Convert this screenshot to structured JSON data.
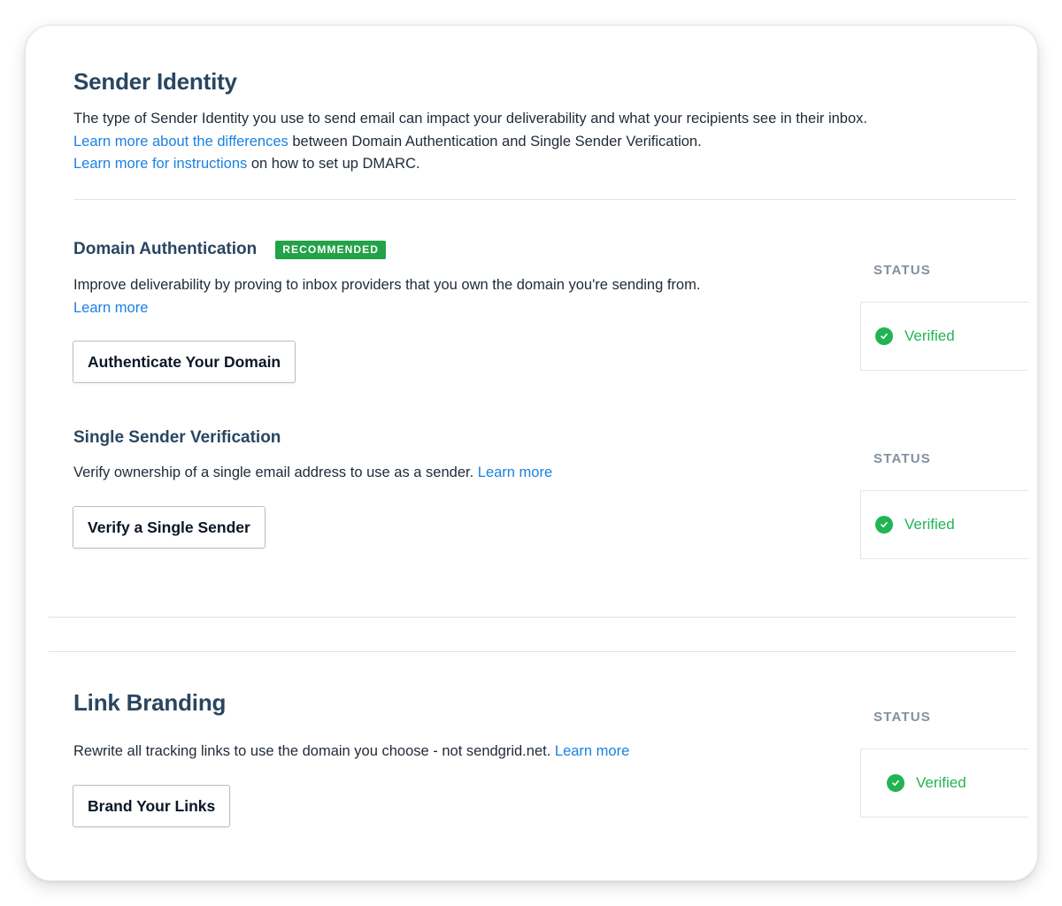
{
  "sender_identity": {
    "title": "Sender Identity",
    "description": "The type of Sender Identity you use to send email can impact your deliverability and what your recipients see in their inbox.",
    "differences_link": "Learn more about the differences",
    "differences_text": " between Domain Authentication and Single Sender Verification.",
    "instructions_link": "Learn more for instructions",
    "instructions_text": " on how to set up DMARC."
  },
  "domain_auth": {
    "title": "Domain Authentication",
    "badge": "RECOMMENDED",
    "description": "Improve deliverability by proving to inbox providers that you own the domain you're sending from.",
    "learn_more": "Learn more",
    "button": "Authenticate Your Domain",
    "status_label": "STATUS",
    "status_value": "Verified"
  },
  "single_sender": {
    "title": "Single Sender Verification",
    "description": "Verify ownership of a single email address to use as a sender.",
    "learn_more": "Learn more",
    "button": "Verify a Single Sender",
    "status_label": "STATUS",
    "status_value": "Verified"
  },
  "link_branding": {
    "title": "Link Branding",
    "description": "Rewrite all tracking links to use the domain you choose - not sendgrid.net.",
    "learn_more": "Learn more",
    "button": "Brand Your Links",
    "status_label": "STATUS",
    "status_value": "Verified"
  },
  "icons": {
    "status": "check-circle-icon"
  },
  "colors": {
    "heading": "#294661",
    "link": "#1a82e2",
    "badge": "#23a247",
    "verified": "#22b453",
    "status_label": "#8190a0"
  }
}
